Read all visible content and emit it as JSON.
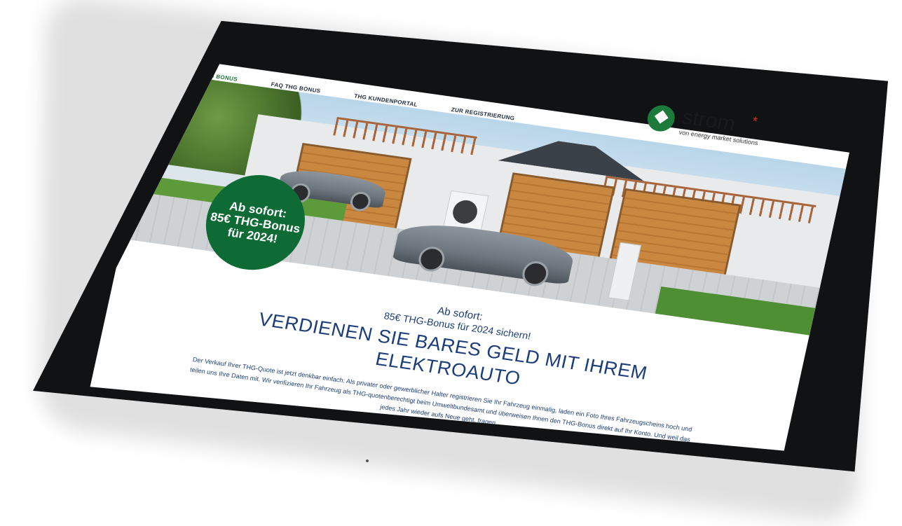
{
  "nav": {
    "items": [
      {
        "label": "THG BONUS",
        "active": true
      },
      {
        "label": "FAQ THG BONUS",
        "active": false
      },
      {
        "label": "THG KUNDENPORTAL",
        "active": false
      },
      {
        "label": "ZUR REGISTRIERUNG",
        "active": false
      }
    ]
  },
  "logo": {
    "name": "strom",
    "star": "*",
    "subtitle": "von energy market solutions"
  },
  "badge": {
    "line1": "Ab sofort:",
    "line2": "85€ THG-Bonus",
    "line3": "für 2024!"
  },
  "intro": {
    "kicker1": "Ab sofort:",
    "kicker2": "85€ THG-Bonus für 2024 sichern!",
    "headline_line1": "VERDIENEN SIE BARES GELD MIT IHREM",
    "headline_line2": "ELEKTROAUTO"
  },
  "body": {
    "text": "Der Verkauf Ihrer THG-Quote ist jetzt denkbar einfach: Als privater oder gewerblicher Halter registrieren Sie Ihr Fahrzeug einmalig, laden ein Foto Ihres Fahrzeugscheins hoch und teilen uns Ihre Daten mit. Wir verifizieren Ihr Fahrzeug als THG-quotenberechtigt beim Umweltbundesamt und überweisen Ihnen den THG-Bonus direkt auf Ihr Konto. Und weil das jedes Jahr wieder aufs Neue geht, fragen"
  },
  "colors": {
    "brand_green": "#0f6b35",
    "nav_active": "#1d7a3b",
    "text_blue": "#1b3d7a",
    "logo_star": "#d0312d"
  }
}
